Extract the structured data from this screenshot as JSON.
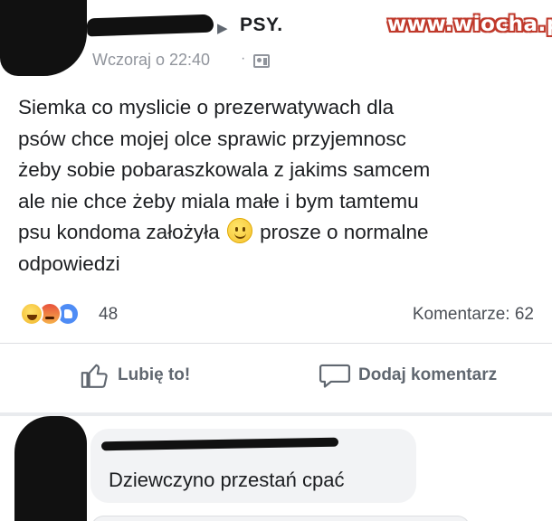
{
  "watermark": "www.wiocha.pl",
  "post": {
    "group_name": "PSY.",
    "header_arrow": "▶",
    "timestamp": "Wczoraj o 22:40",
    "separator": "·",
    "audience_icon": "friends-icon",
    "text_lines": [
      "Siemka co myslicie o prezerwatywach dla",
      "psów chce mojej olce sprawic przyjemnosc",
      "żeby sobie pobaraszkowala z jakims samcem",
      "ale nie chce żeby miala małe i bym tamtemu",
      "psu kondoma założyła",
      "prosze o normalne",
      "odpowiedzi"
    ],
    "reactions": [
      "haha",
      "angry",
      "like"
    ],
    "reaction_count": "48",
    "comment_count": "Komentarze: 62"
  },
  "actions": {
    "like_label": "Lubię to!",
    "comment_label": "Dodaj komentarz"
  },
  "comment": {
    "text": "Dziewczyno przestań cpać"
  },
  "colors": {
    "text": "#1c1e21",
    "secondary": "#90949c",
    "action": "#606770",
    "bubble": "#f2f3f5",
    "like_blue": "#4e8cf5",
    "watermark_red": "#c0392b"
  }
}
